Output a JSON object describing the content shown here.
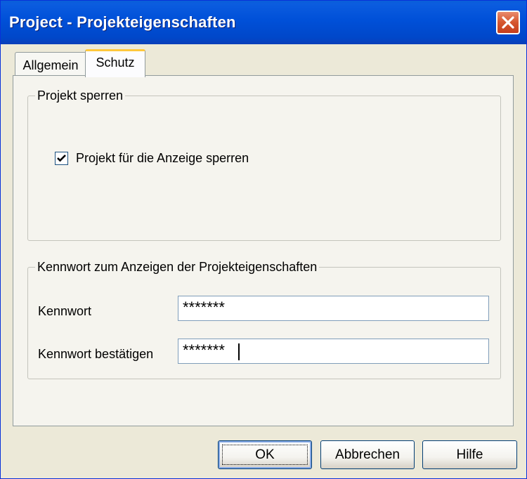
{
  "window": {
    "title": "Project - Projekteigenschaften",
    "close_icon": "close-icon"
  },
  "tabs": [
    {
      "label": "Allgemein",
      "selected": false
    },
    {
      "label": "Schutz",
      "selected": true
    }
  ],
  "lock_group": {
    "legend": "Projekt sperren",
    "checkbox_label": "Projekt für die Anzeige sperren",
    "checked": true
  },
  "password_group": {
    "legend": "Kennwort zum Anzeigen der Projekteigenschaften",
    "password_label": "Kennwort",
    "password_value": "*******",
    "confirm_label": "Kennwort bestätigen",
    "confirm_value": "*******"
  },
  "buttons": {
    "ok": "OK",
    "cancel": "Abbrechen",
    "help": "Hilfe"
  },
  "colors": {
    "titlebar": "#0050d8",
    "close_button": "#d5562f",
    "selected_tab_accent": "#ffc83c",
    "dialog_background": "#ece9d8"
  }
}
